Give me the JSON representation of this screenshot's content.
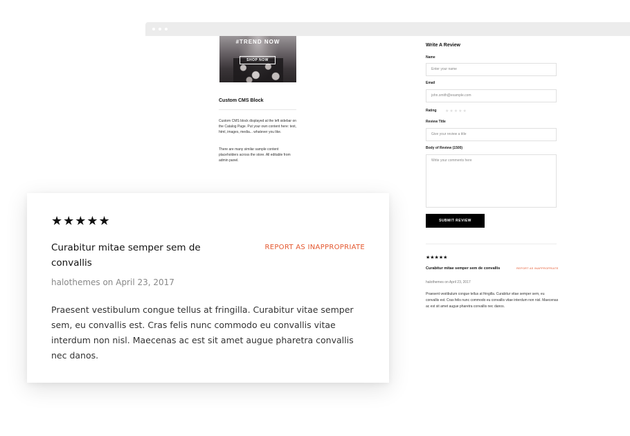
{
  "banner": {
    "heading": "#TREND NOW",
    "button_label": "SHOP NOW"
  },
  "cms_block": {
    "title": "Custom CMS Block",
    "paragraph1": "Custom CMS block displayed at the left sidebar on the Catalog Page. Put your own content here: text, html, images, media... whatever you like.",
    "paragraph2": "There are many similar sample content placeholders across the store. All editable from admin panel."
  },
  "review_form": {
    "title": "Write A Review",
    "name_label": "Name",
    "name_placeholder": "Enter your name",
    "email_label": "Email",
    "email_placeholder": "john.smith@example.com",
    "rating_label": "Rating",
    "rating_stars": "★★★★★",
    "review_title_label": "Review Title",
    "review_title_placeholder": "Give your review a title",
    "body_label": "Body of Review (1500)",
    "body_placeholder": "Write your comments here",
    "submit_label": "SUBMIT REVIEW"
  },
  "review": {
    "stars": "★★★★★",
    "rating": 5,
    "title": "Curabitur mitae semper sem de convallis",
    "report_label": "REPORT AS INAPPROPRIATE",
    "meta": "halothemes on April 23, 2017",
    "body": "Praesent vestibulum congue tellus at fringilla. Curabitur vitae semper sem, eu convallis est. Cras felis nunc commodo eu convallis vitae interdum non nisl. Maecenas ac est sit amet augue pharetra convallis nec danos."
  },
  "colors": {
    "accent": "#e4572e",
    "button_bg": "#000000",
    "window_bar": "#ececec"
  }
}
